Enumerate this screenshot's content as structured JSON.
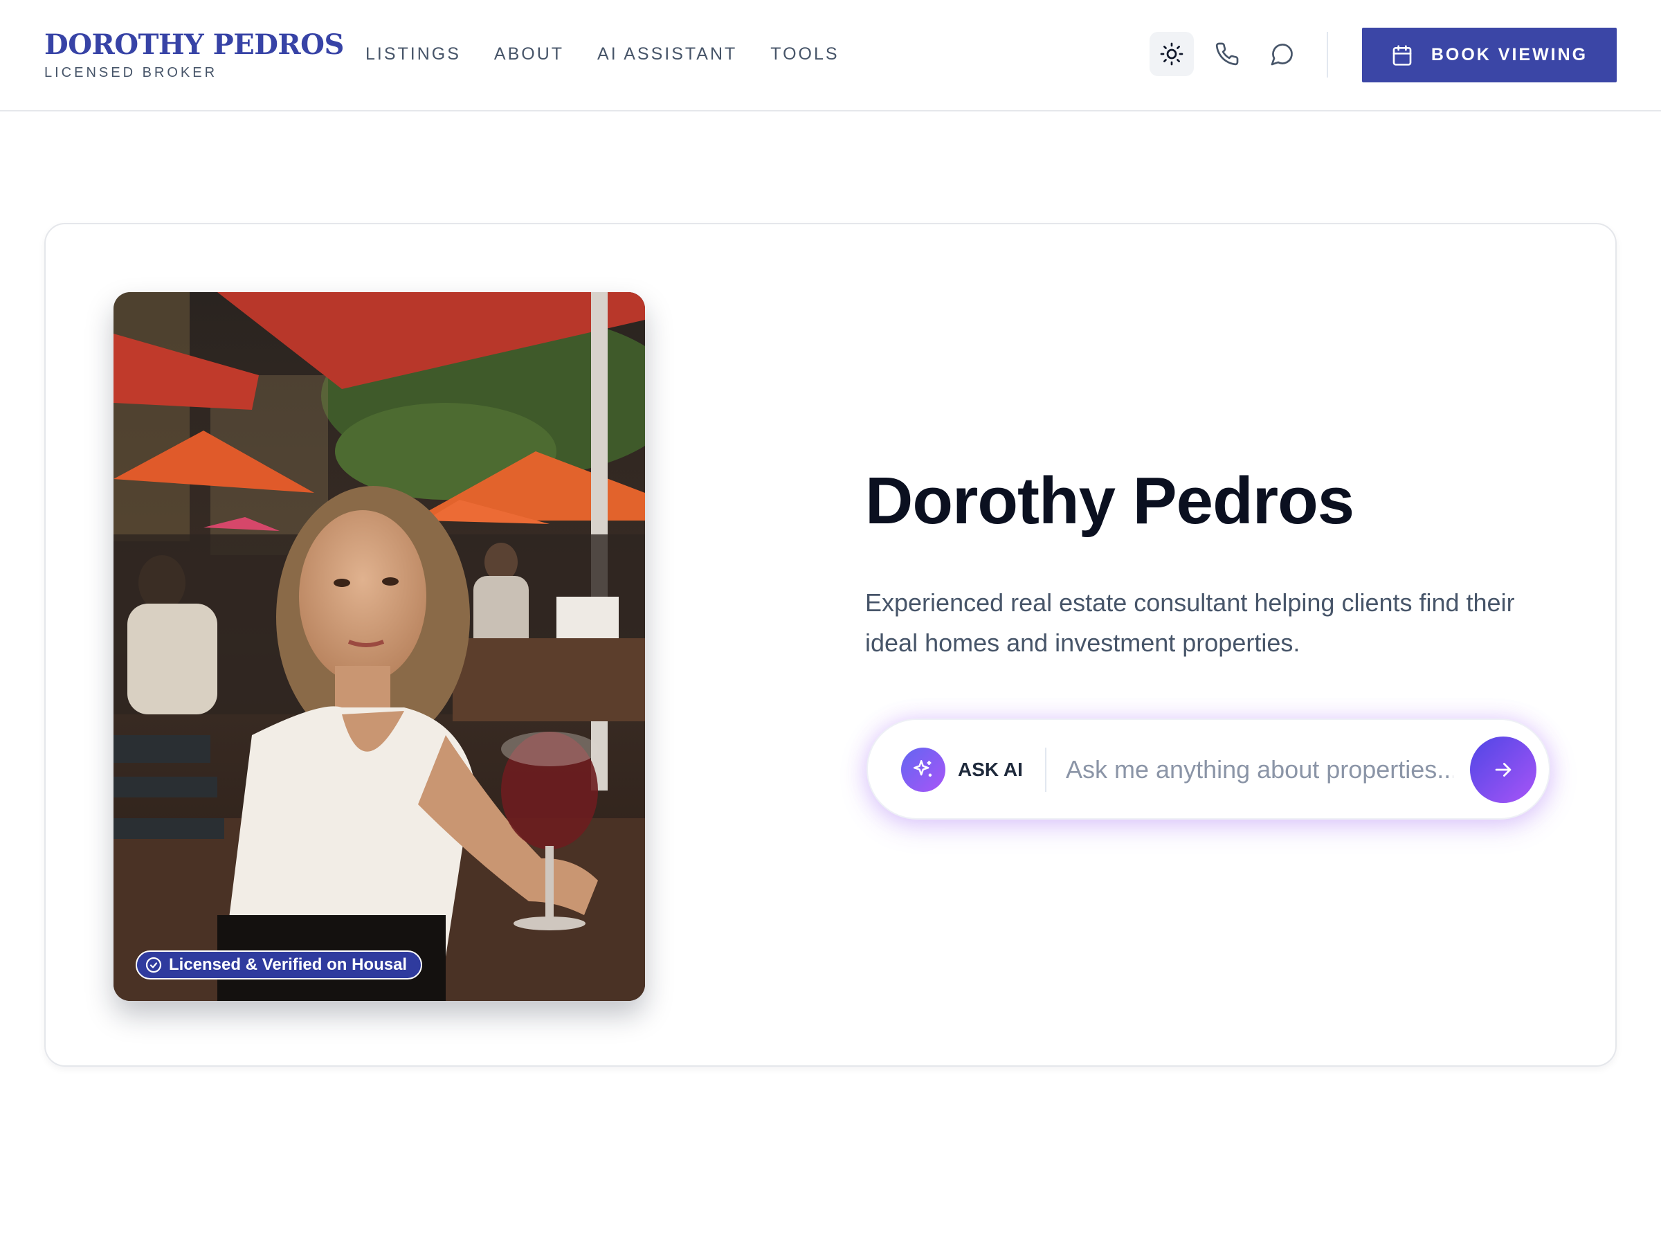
{
  "brand": {
    "name": "DOROTHY PEDROS",
    "subtitle": "LICENSED BROKER",
    "color": "#3743a6"
  },
  "nav": {
    "items": [
      {
        "label": "LISTINGS"
      },
      {
        "label": "ABOUT"
      },
      {
        "label": "AI ASSISTANT"
      },
      {
        "label": "TOOLS"
      }
    ]
  },
  "header_icons": [
    {
      "icon": "sun-icon",
      "active": true
    },
    {
      "icon": "phone-icon",
      "active": false
    },
    {
      "icon": "chat-icon",
      "active": false
    }
  ],
  "cta": {
    "label": "BOOK VIEWING",
    "icon": "calendar-icon",
    "color": "#3b46a6"
  },
  "profile": {
    "badge": "Licensed & Verified on Housal",
    "name": "Dorothy Pedros",
    "description": "Experienced real estate consultant helping clients find their ideal homes and investment properties."
  },
  "ask_ai": {
    "label": "ASK AI",
    "placeholder": "Ask me anything about properties...",
    "value": ""
  },
  "colors": {
    "accent": "#3b46a6",
    "gradient_start": "#4f46e5",
    "gradient_end": "#a855f7"
  }
}
